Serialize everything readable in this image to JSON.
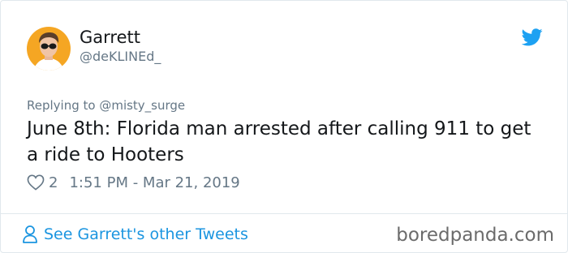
{
  "author": {
    "name": "Garrett",
    "handle": "@deKLINEd_"
  },
  "tweet": {
    "replying_to": "Replying to @misty_surge",
    "text": "June 8th: Florida man arrested after calling 911 to get a ride to Hooters",
    "likes": "2",
    "timestamp": "1:51 PM - Mar 21, 2019"
  },
  "footer": {
    "other_tweets_label": "See Garrett's other Tweets"
  },
  "watermark": "boredpanda.com",
  "colors": {
    "twitter_blue": "#1da1f2",
    "link_blue": "#1b95e0",
    "secondary_text": "#657786",
    "avatar_background": "#f5a623"
  },
  "icons": {
    "brand": "twitter-bird-icon",
    "like": "heart-icon",
    "profile": "person-icon"
  }
}
